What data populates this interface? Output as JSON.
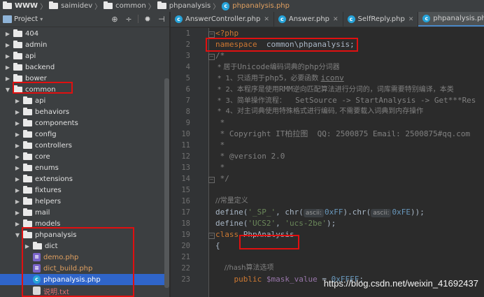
{
  "breadcrumb": [
    "WWW",
    "saimidev",
    "common",
    "phpanalysis",
    "phpanalysis.php"
  ],
  "project": {
    "title": "Project",
    "tree": [
      {
        "label": "404",
        "depth": 1,
        "type": "folder",
        "expanded": false
      },
      {
        "label": "admin",
        "depth": 1,
        "type": "folder",
        "expanded": false
      },
      {
        "label": "api",
        "depth": 1,
        "type": "folder",
        "expanded": false
      },
      {
        "label": "backend",
        "depth": 1,
        "type": "folder",
        "expanded": false
      },
      {
        "label": "bower",
        "depth": 1,
        "type": "folder",
        "expanded": false
      },
      {
        "label": "common",
        "depth": 1,
        "type": "folder",
        "expanded": true
      },
      {
        "label": "api",
        "depth": 2,
        "type": "folder",
        "expanded": false
      },
      {
        "label": "behaviors",
        "depth": 2,
        "type": "folder",
        "expanded": false
      },
      {
        "label": "components",
        "depth": 2,
        "type": "folder",
        "expanded": false
      },
      {
        "label": "config",
        "depth": 2,
        "type": "folder",
        "expanded": false
      },
      {
        "label": "controllers",
        "depth": 2,
        "type": "folder",
        "expanded": false
      },
      {
        "label": "core",
        "depth": 2,
        "type": "folder",
        "expanded": false
      },
      {
        "label": "enums",
        "depth": 2,
        "type": "folder",
        "expanded": false
      },
      {
        "label": "extensions",
        "depth": 2,
        "type": "folder",
        "expanded": false
      },
      {
        "label": "fixtures",
        "depth": 2,
        "type": "folder",
        "expanded": false
      },
      {
        "label": "helpers",
        "depth": 2,
        "type": "folder",
        "expanded": false
      },
      {
        "label": "mail",
        "depth": 2,
        "type": "folder",
        "expanded": false
      },
      {
        "label": "models",
        "depth": 2,
        "type": "folder",
        "expanded": false
      },
      {
        "label": "phpanalysis",
        "depth": 2,
        "type": "folder",
        "expanded": true
      },
      {
        "label": "dict",
        "depth": 3,
        "type": "folder",
        "expanded": false
      },
      {
        "label": "demo.php",
        "depth": 3,
        "type": "php"
      },
      {
        "label": "dict_build.php",
        "depth": 3,
        "type": "php"
      },
      {
        "label": "phpanalysis.php",
        "depth": 3,
        "type": "class",
        "selected": true
      },
      {
        "label": "说明.txt",
        "depth": 3,
        "type": "txt"
      }
    ]
  },
  "tabs": [
    {
      "label": "AnswerController.php",
      "icon": "c",
      "active": false
    },
    {
      "label": "Answer.php",
      "icon": "c",
      "active": false
    },
    {
      "label": "SelfReply.php",
      "icon": "c",
      "active": false
    },
    {
      "label": "phpanalysis.php",
      "icon": "c",
      "active": true
    }
  ],
  "code": {
    "line_numbers": [
      "1",
      "2",
      "3",
      "4",
      "5",
      "6",
      "7",
      "8",
      "9",
      "10",
      "11",
      "12",
      "13",
      "14",
      "15",
      "16",
      "17",
      "18",
      "19",
      "20",
      "21",
      "22",
      "23"
    ],
    "l1": "<?php",
    "l2_kw": "namespace",
    "l2_ns": "common\\phpanalysis;",
    "l3": "/*",
    "l4_a": " * 居于",
    "l4_b": "Unicode",
    "l4_c": "编码词典的",
    "l4_d": "php",
    "l4_e": "分词器",
    "l5_a": " *  1、只适用于",
    "l5_b": "php5",
    "l5_c": "，必要函数 ",
    "l5_d": "iconv",
    "l6_a": " *  2、本程序是使用",
    "l6_b": "RMM",
    "l6_c": "逆向匹配算法进行分词的，词库需要特别编译，本类",
    "l7_a": " *  3、简单操作流程：",
    "l7_b": "  SetSource -> StartAnalysis -> Get***Res",
    "l8": " *  4、对主词典使用特殊格式进行编码, 不需要载入词典到内存操作",
    "l9": " *",
    "l10": " * Copyright IT柏拉图  QQ: 2500875 Email: 2500875#qq.com",
    "l11": " *",
    "l12": " * @version 2.0",
    "l13": " *",
    "l14": " */",
    "l15": "",
    "l16": "//常量定义",
    "l17_a": "define(",
    "l17_s": "'_SP_'",
    "l17_b": ", chr(",
    "l17_h": "ascii:",
    "l17_n": "0xFF",
    "l17_c": ").chr(",
    "l17_h2": "ascii:",
    "l17_n2": "0xFE",
    "l17_d": "));",
    "l18_a": "define(",
    "l18_s": "'UCS2'",
    "l18_b": ", ",
    "l18_s2": "'ucs-2be'",
    "l18_c": ");",
    "l19_kw": "class",
    "l19_name": "PhpAnalysis",
    "l20": "{",
    "l21": "",
    "l22": "    //hash算法选项",
    "l23_kw": "    public ",
    "l23_var": "$mask_value",
    "l23_b": " = ",
    "l23_n": "0xFFFF",
    "l23_c": ";"
  },
  "watermark": "https://blog.csdn.net/weixin_41692437",
  "colors": {
    "highlight_box": "#e01010",
    "selection": "#2f65ca",
    "tab_accent": "#4a88c7"
  }
}
